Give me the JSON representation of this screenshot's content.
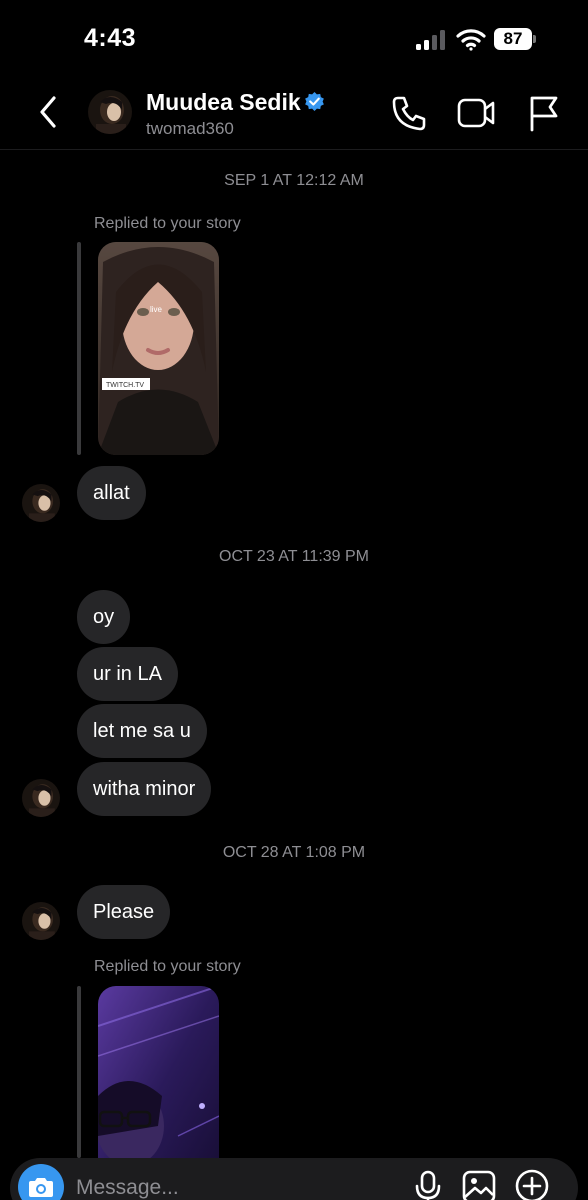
{
  "status_bar": {
    "time": "4:43",
    "battery": "87"
  },
  "header": {
    "name": "Muudea Sedik",
    "username": "twomad360",
    "verified_color": "#3797f0"
  },
  "thread": {
    "timestamp_1": "SEP 1 AT 12:12 AM",
    "reply_label_1": "Replied to your story",
    "story_1_overlay": "live",
    "story_1_sticker": "TWITCH.TV",
    "msg_allat": "allat",
    "timestamp_2": "OCT 23 AT 11:39 PM",
    "msg_oy": "oy",
    "msg_la": "ur in LA",
    "msg_sa": "let me sa u",
    "msg_minor": "witha minor",
    "timestamp_3": "OCT 28 AT 1:08 PM",
    "msg_please": "Please",
    "reply_label_2": "Replied to your story"
  },
  "composer": {
    "placeholder": "Message...",
    "camera_color": "#3797f0"
  },
  "colors": {
    "background": "#000000",
    "bubble": "#262628",
    "secondary_text": "#8e8e93"
  }
}
